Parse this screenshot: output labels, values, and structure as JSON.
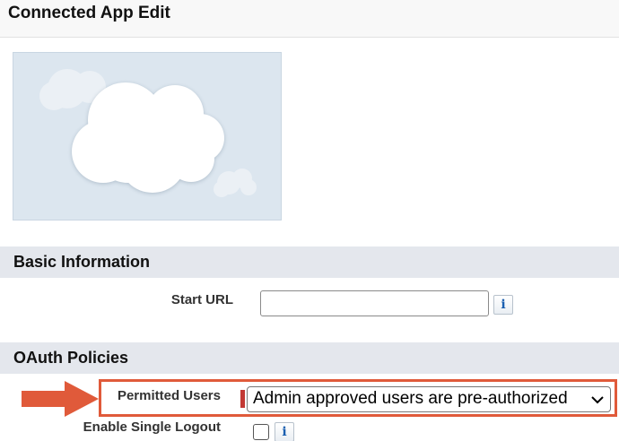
{
  "page": {
    "title": "Connected App Edit"
  },
  "logo": {
    "icon": "cloud-logo-icon"
  },
  "sections": {
    "basic_information": {
      "title": "Basic Information",
      "start_url": {
        "label": "Start URL",
        "value": "",
        "info_glyph": "i"
      }
    },
    "oauth_policies": {
      "title": "OAuth Policies",
      "permitted_users": {
        "label": "Permitted Users",
        "selected": "Admin approved users are pre-authorized"
      },
      "single_logout": {
        "label": "Enable Single Logout",
        "checked": false,
        "info_glyph": "i"
      }
    }
  },
  "colors": {
    "highlight": "#e05a3a",
    "section_bg": "#e4e7ed",
    "logo_bg": "#dce6ef",
    "required": "#c23934"
  }
}
